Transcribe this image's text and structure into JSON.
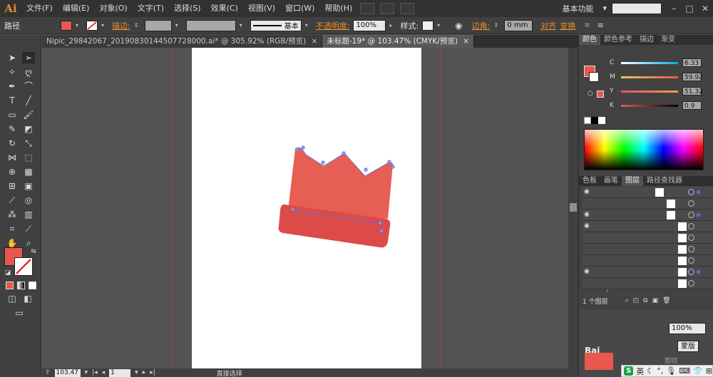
{
  "app": {
    "logo": "Ai",
    "menu": [
      "文件(F)",
      "编辑(E)",
      "对象(O)",
      "文字(T)",
      "选择(S)",
      "效果(C)",
      "视图(V)",
      "窗口(W)",
      "帮助(H)"
    ],
    "workspace": "基本功能",
    "workspace_arrow": "▾"
  },
  "control_bar": {
    "selection_type": "路径",
    "fill_color": "#e8584f",
    "stroke_label": "描边:",
    "stroke_style": "基本",
    "opacity_label": "不透明度:",
    "opacity_value": "100%",
    "style_label": "样式:",
    "corner_label": "边角:",
    "corner_value": "0 mm",
    "align_label": "对齐",
    "transform_label": "变换"
  },
  "tabs": [
    {
      "label": "Nipic_29842067_20190830144507728000.ai* @ 305.92% (RGB/预览)",
      "close": "×"
    },
    {
      "label": "未标题-19* @ 103.47% (CMYK/预览)",
      "close": "×"
    }
  ],
  "status": {
    "zoom": "103.47",
    "page": "1",
    "tool": "直接选择"
  },
  "colors": {
    "fill": "#e8584f",
    "shape_top": "#e75e54",
    "shape_band": "#dc4b48",
    "anchor": "#5b6ee0"
  },
  "color_panel": {
    "tabs": [
      "颜色",
      "颜色参考",
      "描边",
      "渐变"
    ],
    "channels": [
      {
        "label": "C",
        "value": "6.33",
        "gradient": "linear-gradient(to right,#ffffff,#00aeef)"
      },
      {
        "label": "M",
        "value": "59.92",
        "gradient": "linear-gradient(to right,#f0c060,#e8584f)"
      },
      {
        "label": "Y",
        "value": "51.32",
        "gradient": "linear-gradient(to right,#e05080,#f0a030)"
      },
      {
        "label": "K",
        "value": "0.9",
        "gradient": "linear-gradient(to right,#e8584f,#000000)"
      }
    ]
  },
  "layers_panel": {
    "tabs": [
      "色板",
      "画笔",
      "图层",
      "路径查找器"
    ],
    "footer": "1 个图层"
  },
  "overlay": {
    "mid": "Bai"
  },
  "properties_panel": {
    "value": "100%",
    "button": "蒙版",
    "label": "剪切"
  },
  "ime": {
    "logo": "S",
    "lang": "英"
  }
}
